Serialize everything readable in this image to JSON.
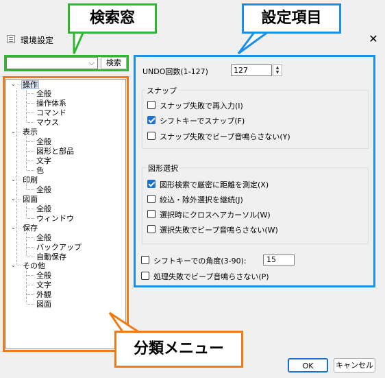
{
  "dialog": {
    "title": "環境設定",
    "close_symbol": "✕"
  },
  "callouts": {
    "search": "検索窓",
    "settings": "設定項目",
    "menu": "分類メニュー"
  },
  "search": {
    "value": "",
    "button_label": "検索"
  },
  "tree": {
    "cat_operation": "操作",
    "op_general": "全般",
    "op_system": "操作体系",
    "op_command": "コマンド",
    "op_mouse": "マウス",
    "cat_display": "表示",
    "disp_general": "全般",
    "disp_shapes": "図形と部品",
    "disp_text": "文字",
    "disp_color": "色",
    "cat_print": "印刷",
    "print_general": "全般",
    "cat_drawing": "図面",
    "draw_general": "全般",
    "draw_window": "ウィンドウ",
    "cat_save": "保存",
    "save_general": "全般",
    "save_backup": "バックアップ",
    "save_auto": "自動保存",
    "cat_other": "その他",
    "other_general": "全般",
    "other_text": "文字",
    "other_appearance": "外観",
    "other_drawing": "図面"
  },
  "settings": {
    "undo_label": "UNDO回数(1-127)",
    "undo_value": "127",
    "snap_group": "スナップ",
    "snap_retry": {
      "label": "スナップ失敗で再入力(I)",
      "checked": false
    },
    "snap_shift": {
      "label": "シフトキーでスナップ(F)",
      "checked": true
    },
    "snap_nobeep": {
      "label": "スナップ失敗でビープ音鳴らさない(Y)",
      "checked": false
    },
    "shape_group": "図形選択",
    "shape_distance": {
      "label": "図形検索で厳密に距離を測定(X)",
      "checked": true
    },
    "shape_continue": {
      "label": "絞込・除外選択を継続(J)",
      "checked": false
    },
    "shape_cross": {
      "label": "選択時にクロスヘアカーソル(W)",
      "checked": false
    },
    "shape_nobeep": {
      "label": "選択失敗でビープ音鳴らさない(W)",
      "checked": false
    },
    "shift_angle": {
      "label": "シフトキーでの角度(3-90):",
      "checked": false
    },
    "angle_value": "15",
    "process_nobeep": {
      "label": "処理失敗でビープ音鳴らさない(P)",
      "checked": false
    }
  },
  "buttons": {
    "ok": "OK",
    "cancel": "キャンセル"
  }
}
